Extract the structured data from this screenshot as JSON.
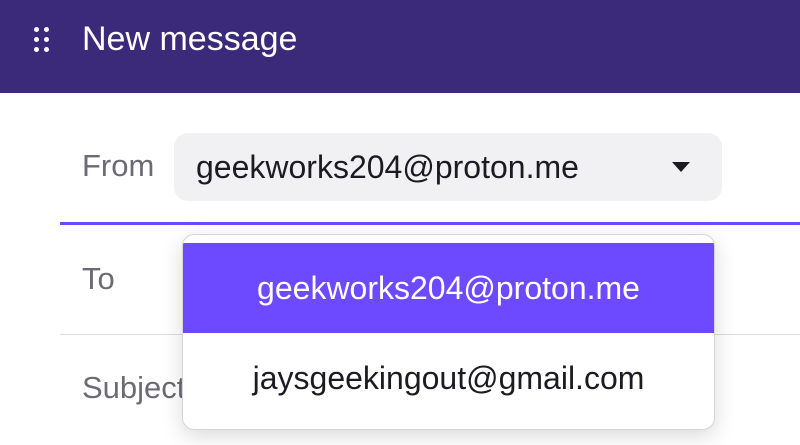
{
  "window": {
    "title": "New message",
    "drag_icon": "drag-handle-icon"
  },
  "composer": {
    "from_label": "From",
    "from_value": "geekworks204@proton.me",
    "to_label": "To",
    "subject_label": "Subject"
  },
  "dropdown": {
    "options": [
      {
        "label": "geekworks204@proton.me",
        "selected": true
      },
      {
        "label": "jaysgeekingout@gmail.com",
        "selected": false
      }
    ]
  },
  "colors": {
    "header_bg": "#3b2a7a",
    "accent": "#6d4aff",
    "select_bg": "#f1f0f3"
  }
}
